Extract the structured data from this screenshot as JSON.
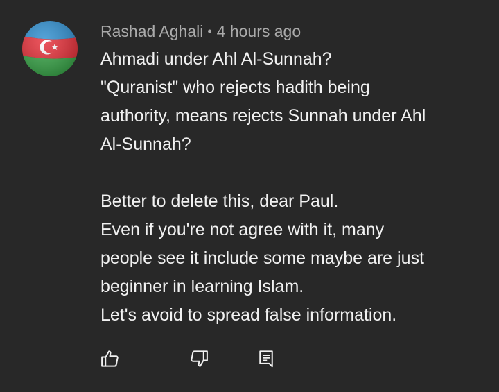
{
  "comment": {
    "author": "Rashad Aghali",
    "separator": "•",
    "timestamp": "4 hours ago",
    "text_lines": [
      "Ahmadi under Ahl Al-Sunnah?",
      "\"Quranist\" who rejects hadith being",
      "authority, means rejects Sunnah under Ahl",
      "Al-Sunnah?",
      "",
      "Better to delete this, dear Paul.",
      "Even if you're not agree with it, many",
      "people see it include some maybe are just",
      "beginner in learning Islam.",
      "Let's avoid to spread false information."
    ]
  },
  "avatar": {
    "image": "azerbaijan-flag",
    "colors": {
      "blue": "#2f8fd0",
      "red": "#e8303a",
      "green": "#3aa84a",
      "emblem": "#ffffff"
    }
  },
  "actions": {
    "like_icon": "thumbs-up-icon",
    "dislike_icon": "thumbs-down-icon",
    "reply_icon": "reply-comment-icon"
  },
  "theme": {
    "background": "#282828",
    "text": "#f1f1f1",
    "secondary_text": "#aaaaaa"
  }
}
